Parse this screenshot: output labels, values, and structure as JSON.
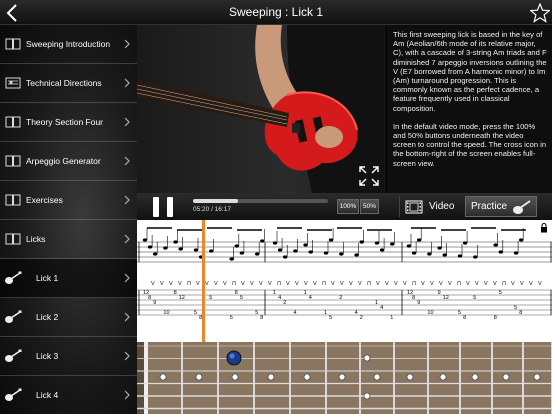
{
  "header": {
    "title": "Sweeping : Lick 1"
  },
  "sidebar": {
    "items": [
      {
        "label": "Sweeping Introduction",
        "icon": "book-icon"
      },
      {
        "label": "Technical Directions",
        "icon": "diagram-icon"
      },
      {
        "label": "Theory Section Four",
        "icon": "book-icon"
      },
      {
        "label": "Arpeggio Generator",
        "icon": "book-icon"
      },
      {
        "label": "Exercises",
        "icon": "book-icon"
      },
      {
        "label": "Licks",
        "icon": "book-icon"
      },
      {
        "label": "Lick 1",
        "icon": "guitar-icon"
      },
      {
        "label": "Lick 2",
        "icon": "guitar-icon"
      },
      {
        "label": "Lick 3",
        "icon": "guitar-icon"
      },
      {
        "label": "Lick 4",
        "icon": "guitar-icon"
      }
    ]
  },
  "description": {
    "p1": "This first sweeping lick is based in the key of Am (Aeolian/6th mode of its relative major, C), with a cascade of 3-string Am triads and F diminished 7 arpeggio inversions outlining the V (E7 borrowed from A harmonic minor) to Im (Am) turnaround progression. This is commonly known as the perfect cadence, a feature frequently used in classical composition.",
    "p2": "In the default video mode, press the 100% and 50% buttons underneath the video screen to control the speed. The cross icon in the bottom-right of the screen enables full-screen view."
  },
  "player": {
    "timecode": "05:20 / 16:17",
    "progress": 0.33,
    "speed_100": "100%",
    "speed_50": "50%",
    "video_label": "Video",
    "practice_label": "Practice"
  },
  "tab": {
    "measure1": [
      "12",
      "8",
      "9",
      "",
      "10",
      "",
      "8",
      "12",
      "",
      "",
      "5",
      "8",
      "",
      "5",
      "",
      "",
      "",
      "5",
      "8",
      "5",
      "",
      "",
      "5",
      "8"
    ],
    "measure2": [
      "1",
      "4",
      "2",
      "",
      "4",
      "",
      "1",
      "4",
      "",
      "",
      "1",
      "5",
      "",
      "2",
      "",
      "",
      "4",
      "2",
      "",
      "",
      "1",
      "4",
      "",
      "1"
    ],
    "measure3": [
      "12",
      "8",
      "9",
      "",
      "10",
      "",
      "9",
      "12",
      "",
      "",
      "5",
      "8",
      "",
      "5",
      "",
      "",
      "",
      "8",
      "5",
      "",
      "",
      "5",
      "8"
    ]
  },
  "colors": {
    "accent": "#e8872a",
    "fret_dot": "#1a3a8a"
  }
}
